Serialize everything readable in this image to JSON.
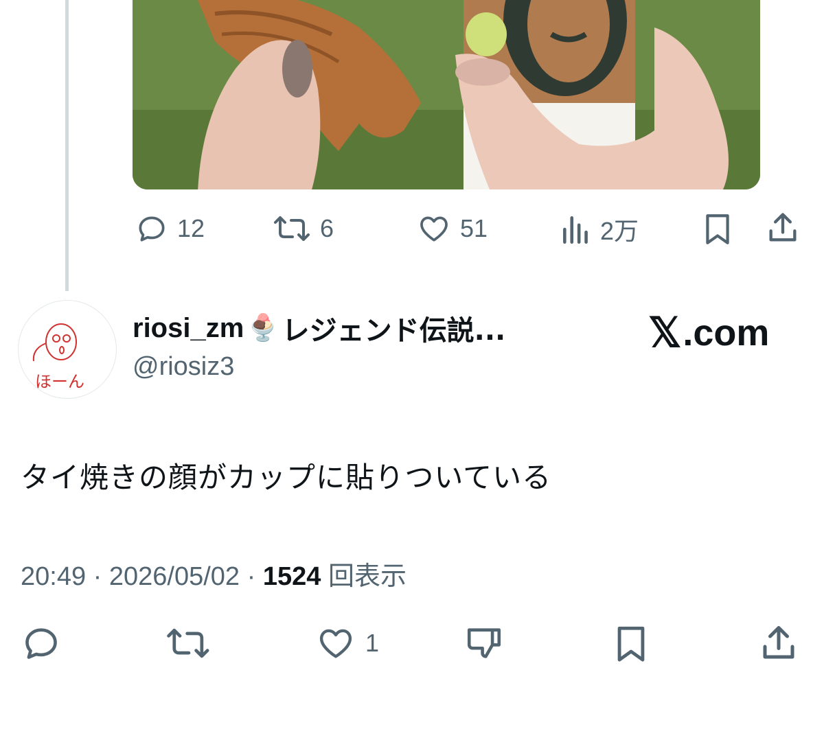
{
  "quoted_post": {
    "actions": {
      "replies": "12",
      "reposts": "6",
      "likes": "51",
      "views": "2万"
    }
  },
  "post": {
    "author_name": "riosi_zm",
    "author_suffix": "レジェンド伝説...",
    "author_emoji": "🍨",
    "handle": "@riosiz3",
    "avatar_text": "ほーん",
    "text": "タイ焼きの顔がカップに貼りついている",
    "time": "20:49",
    "date": "2026/05/02",
    "views_count": "1524",
    "views_label": "回表示",
    "likes": "1"
  },
  "brand": {
    "x_mark": "𝕏",
    "domain": ".com"
  },
  "icons": [
    "reply-icon",
    "repost-icon",
    "like-icon",
    "views-icon",
    "bookmark-icon",
    "share-icon",
    "dislike-icon"
  ],
  "colors": {
    "text": "#0f1419",
    "muted": "#536471",
    "line": "#cfd9de"
  }
}
